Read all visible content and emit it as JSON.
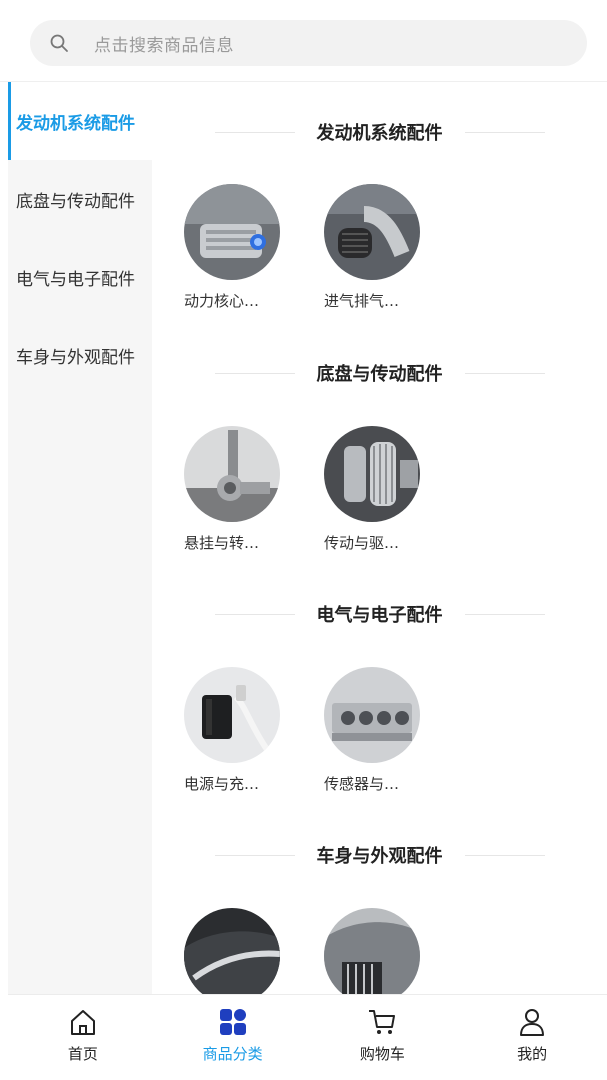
{
  "search": {
    "placeholder": "点击搜索商品信息"
  },
  "sidebar": {
    "items": [
      {
        "label": "发动机系统配件",
        "active": true
      },
      {
        "label": "底盘与传动配件",
        "active": false
      },
      {
        "label": "电气与电子配件",
        "active": false
      },
      {
        "label": "车身与外观配件",
        "active": false
      }
    ]
  },
  "sections": [
    {
      "title": "发动机系统配件",
      "products": [
        {
          "name": "动力核心…",
          "image": "supercharger"
        },
        {
          "name": "进气排气…",
          "image": "air-intake-filter"
        }
      ]
    },
    {
      "title": "底盘与传动配件",
      "products": [
        {
          "name": "悬挂与转…",
          "image": "suspension-arm"
        },
        {
          "name": "传动与驱…",
          "image": "gear-shaft"
        }
      ]
    },
    {
      "title": "电气与电子配件",
      "products": [
        {
          "name": "电源与充…",
          "image": "charger-cable"
        },
        {
          "name": "传感器与…",
          "image": "sensor-block"
        }
      ]
    },
    {
      "title": "车身与外观配件",
      "products": [
        {
          "name": "",
          "image": "body-trim"
        },
        {
          "name": "",
          "image": "front-grille"
        }
      ]
    }
  ],
  "tabbar": {
    "items": [
      {
        "label": "首页",
        "icon": "home-icon",
        "active": false
      },
      {
        "label": "商品分类",
        "icon": "category-icon",
        "active": true
      },
      {
        "label": "购物车",
        "icon": "cart-icon",
        "active": false
      },
      {
        "label": "我的",
        "icon": "user-icon",
        "active": false
      }
    ]
  },
  "colors": {
    "accent": "#1a9be6",
    "category_icon": "#1f3fbf",
    "sidebar_bg": "#f6f6f6",
    "search_bg": "#f2f2f2"
  }
}
